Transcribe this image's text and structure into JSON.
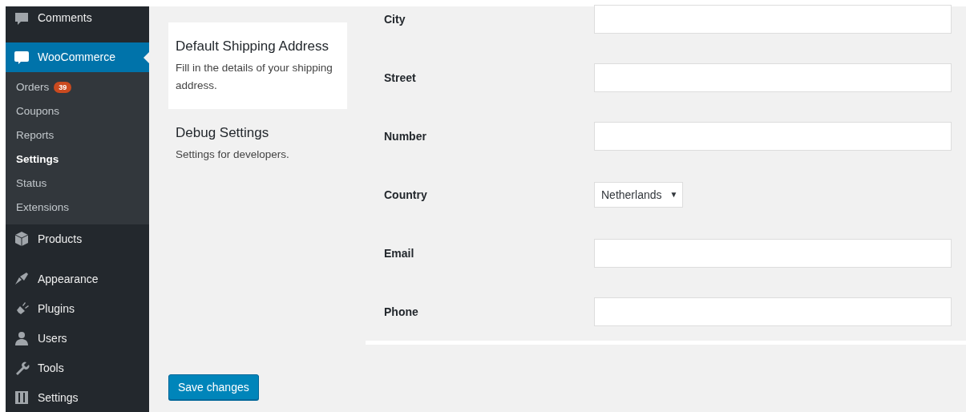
{
  "sidebar": {
    "items": [
      {
        "label": "Comments",
        "current": false
      },
      {
        "label": "WooCommerce",
        "current": true,
        "submenu": [
          {
            "label": "Orders",
            "badge": "39",
            "selected": false
          },
          {
            "label": "Coupons",
            "selected": false
          },
          {
            "label": "Reports",
            "selected": false
          },
          {
            "label": "Settings",
            "selected": true
          },
          {
            "label": "Status",
            "selected": false
          },
          {
            "label": "Extensions",
            "selected": false
          }
        ]
      },
      {
        "label": "Products",
        "current": false
      },
      {
        "label": "Appearance",
        "current": false
      },
      {
        "label": "Plugins",
        "current": false
      },
      {
        "label": "Users",
        "current": false
      },
      {
        "label": "Tools",
        "current": false
      },
      {
        "label": "Settings",
        "current": false
      }
    ]
  },
  "sections": [
    {
      "title": "Default Shipping Address",
      "description": "Fill in the details of your shipping address.",
      "selected": true
    },
    {
      "title": "Debug Settings",
      "description": "Settings for developers.",
      "selected": false
    }
  ],
  "form": {
    "fields": [
      {
        "label": "City",
        "kind": "text"
      },
      {
        "label": "Street",
        "kind": "text"
      },
      {
        "label": "Number",
        "kind": "text"
      },
      {
        "label": "Country",
        "kind": "select",
        "value": "Netherlands",
        "caret": "▼"
      },
      {
        "label": "Email",
        "kind": "text"
      },
      {
        "label": "Phone",
        "kind": "text"
      }
    ]
  },
  "save_button": "Save changes"
}
